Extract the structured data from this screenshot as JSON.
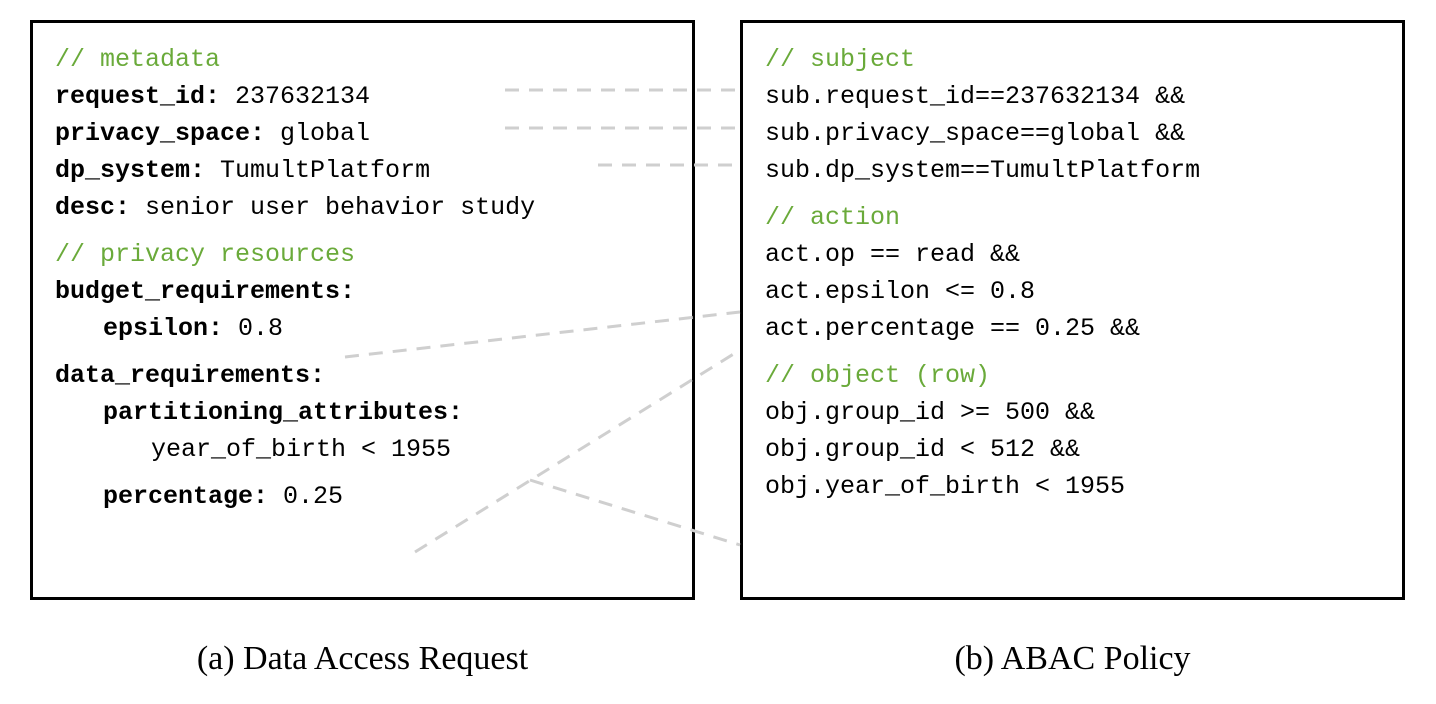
{
  "left": {
    "comment_metadata": "// metadata",
    "request_id_key": "request_id:",
    "request_id_val": " 237632134",
    "privacy_space_key": "privacy_space:",
    "privacy_space_val": " global",
    "dp_system_key": "dp_system:",
    "dp_system_val": " TumultPlatform",
    "desc_key": "desc:",
    "desc_val": " senior user behavior study",
    "comment_privacy": "// privacy resources",
    "budget_key": "budget_requirements:",
    "epsilon_key": "epsilon:",
    "epsilon_val": " 0.8",
    "data_req_key": "data_requirements:",
    "part_attr_key": "partitioning_attributes:",
    "part_attr_val": "year_of_birth < 1955",
    "percentage_key": "percentage:",
    "percentage_val": " 0.25"
  },
  "right": {
    "comment_subject": "// subject",
    "sub_request_id": "sub.request_id==237632134 &&",
    "sub_privacy_space": "sub.privacy_space==global &&",
    "sub_dp_system": "sub.dp_system==TumultPlatform",
    "comment_action": "// action",
    "act_op": "act.op == read &&",
    "act_epsilon": "act.epsilon <= 0.8",
    "act_percentage": "act.percentage == 0.25 &&",
    "comment_object": "// object (row)",
    "obj_group1": "obj.group_id >= 500 &&",
    "obj_group2": "obj.group_id < 512 &&",
    "obj_yob": "obj.year_of_birth < 1955"
  },
  "captions": {
    "left": "(a) Data Access Request",
    "right": "(b) ABAC Policy"
  }
}
